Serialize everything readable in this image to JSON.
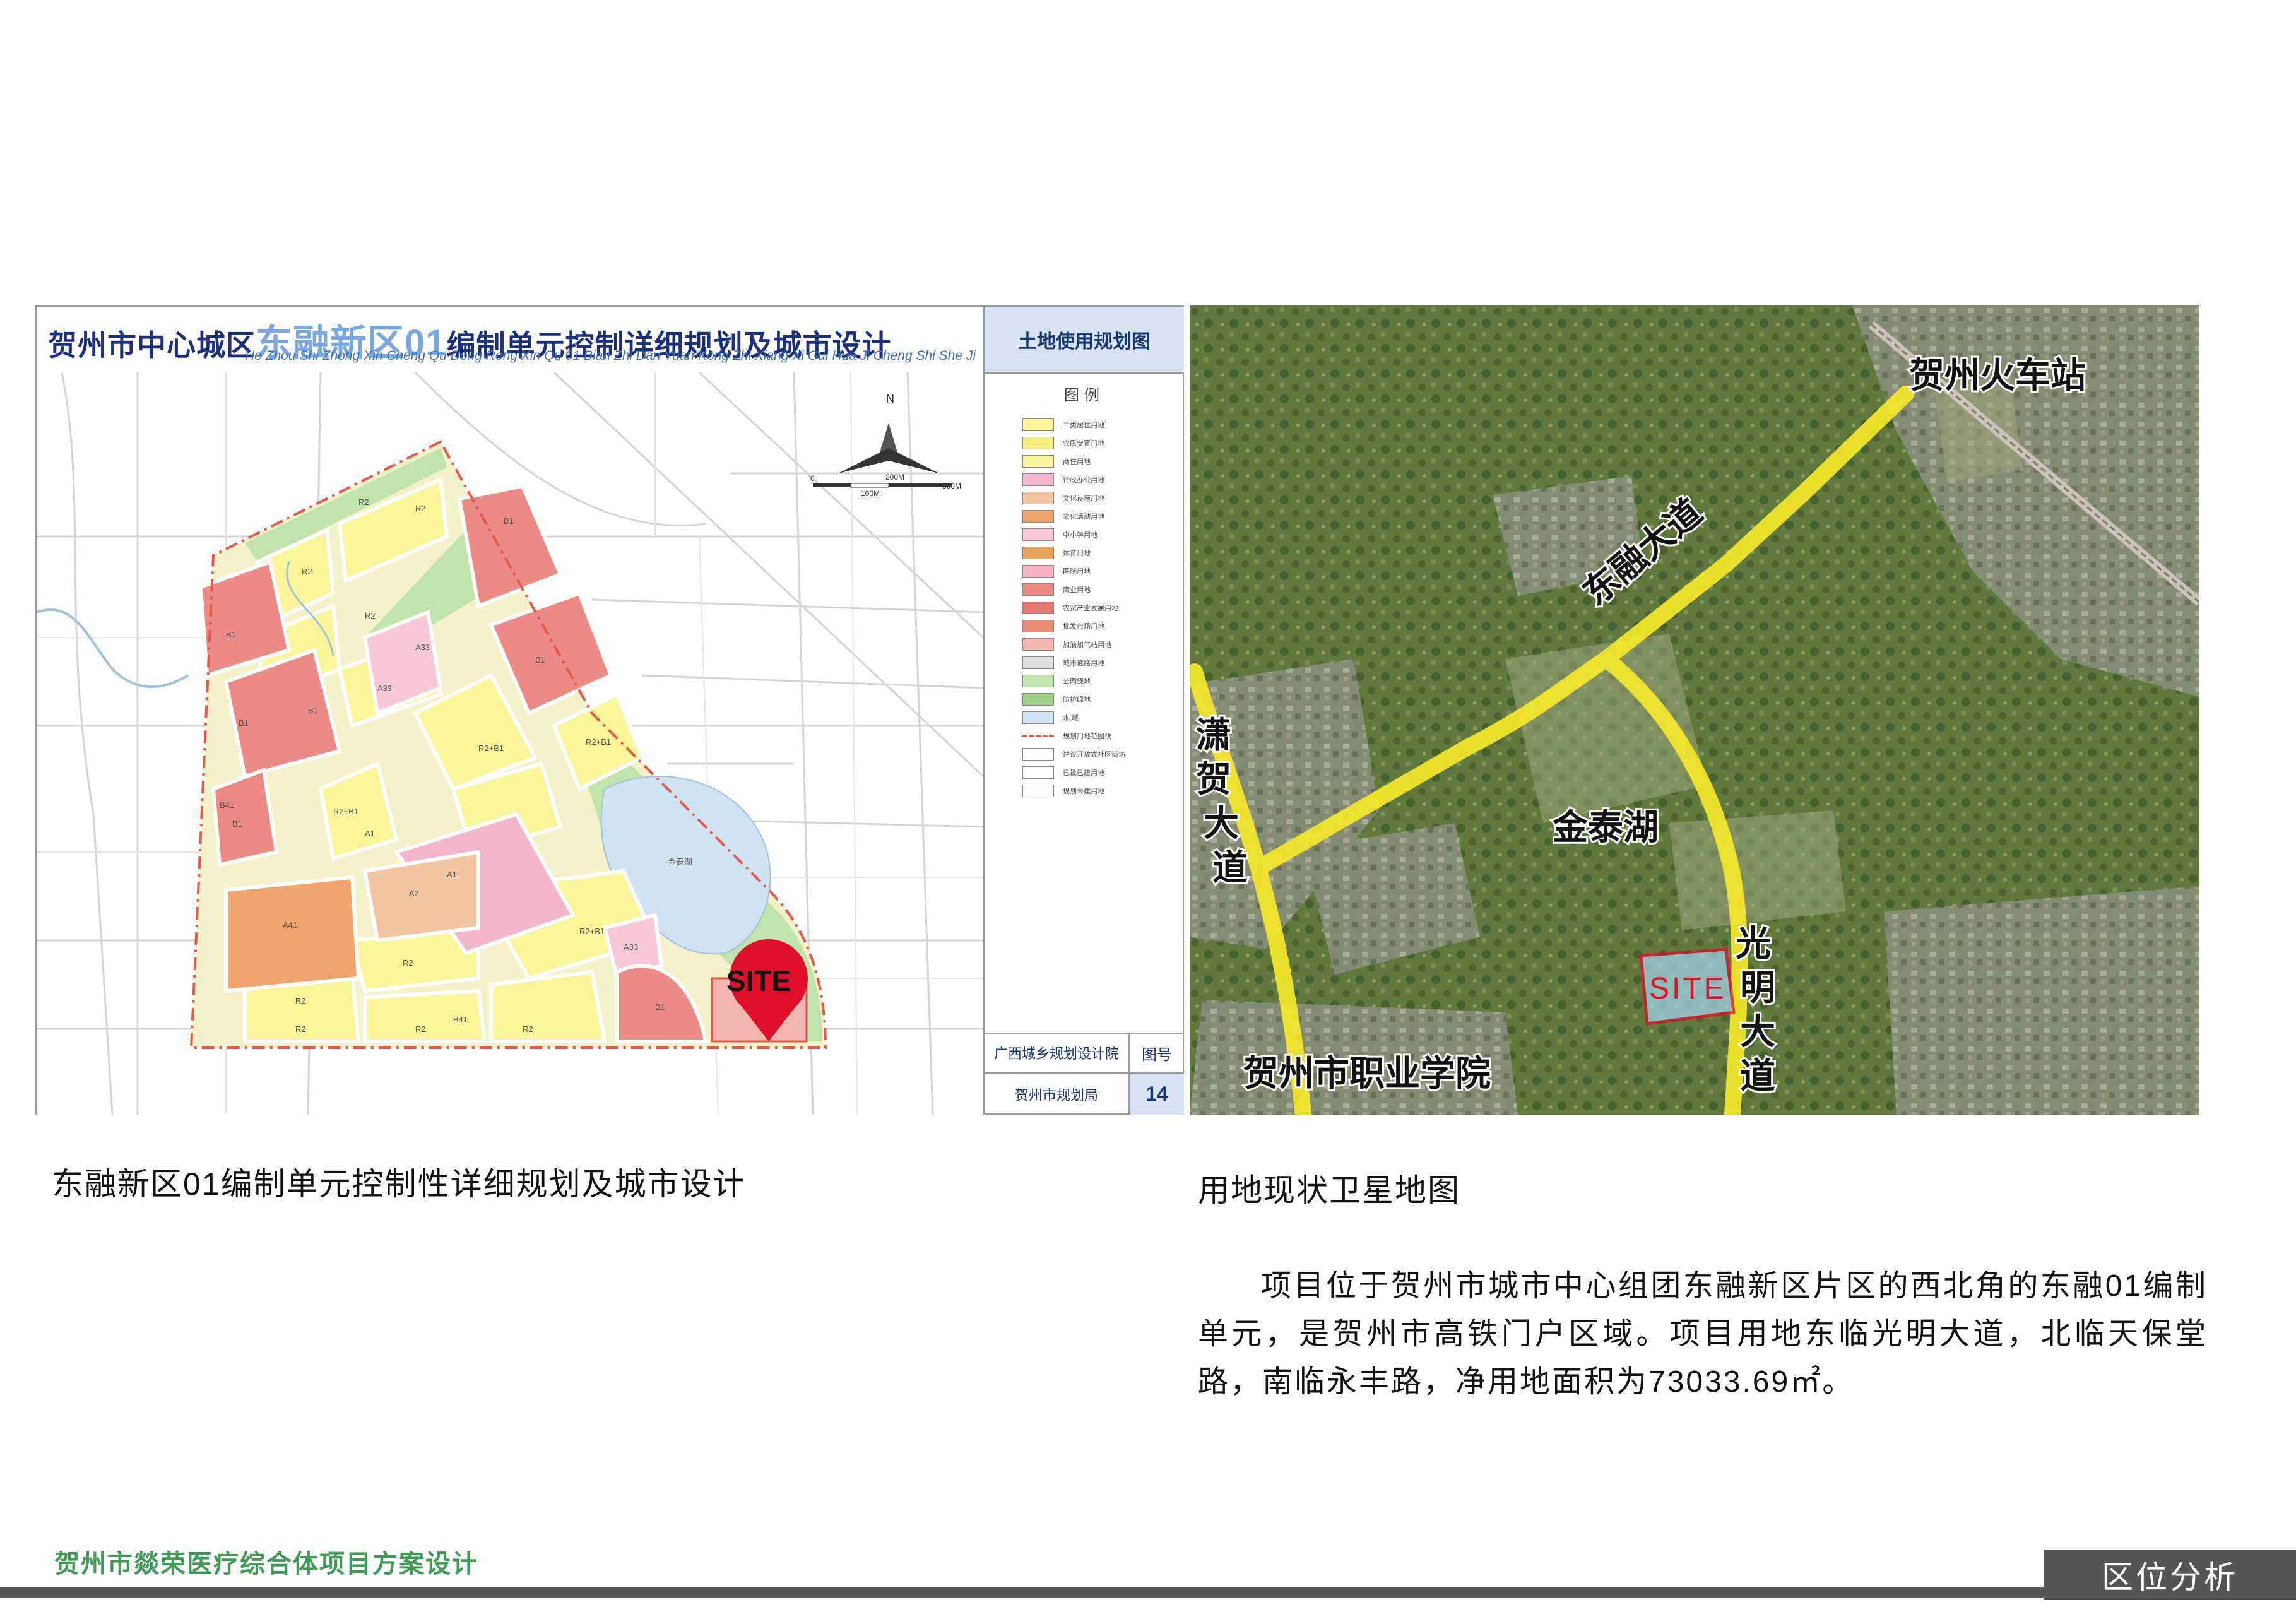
{
  "plan_map": {
    "title_prefix": "贺州市中心城区",
    "title_highlight": "东融新区01",
    "title_suffix": "编制单元控制详细规划及城市设计",
    "pinyin": "He Zhou Shi Zhong Xin Cheng Qu Dong Rong Xin Qu 01 Bian Zhi Dan Yuan Kong Zhi Xiang Xi Gui Hua Ji Cheng Shi She Ji",
    "side_title": "土地使用规划图",
    "legend_title": "图例",
    "legend": [
      {
        "label": "二类居住用地",
        "color": "#fbf59a"
      },
      {
        "label": "农民安置用地",
        "color": "#f4ee7f"
      },
      {
        "label": "商住用地",
        "color": "#f6f39b"
      },
      {
        "label": "行政办公用地",
        "color": "#f6b6c9"
      },
      {
        "label": "文化设施用地",
        "color": "#f3c5a0"
      },
      {
        "label": "文化活动用地",
        "color": "#f0a56d"
      },
      {
        "label": "中小学用地",
        "color": "#f6c8d8"
      },
      {
        "label": "体育用地",
        "color": "#e9a25a"
      },
      {
        "label": "医院用地",
        "color": "#f6b2c1"
      },
      {
        "label": "商业用地",
        "color": "#ec8a86"
      },
      {
        "label": "农贸产业发展用地",
        "color": "#e87a75"
      },
      {
        "label": "批发市场用地",
        "color": "#ee8c7c"
      },
      {
        "label": "加油加气站用地",
        "color": "#f2b5b0"
      },
      {
        "label": "城市道路用地",
        "color": "#dddddd"
      },
      {
        "label": "公园绿地",
        "color": "#bfe3a8"
      },
      {
        "label": "防护绿地",
        "color": "#9fd18a"
      },
      {
        "label": "水 域",
        "color": "#cfe3f2"
      },
      {
        "label": "规划用地范围线",
        "color": "#e35a4a"
      },
      {
        "label": "建议开放式社区街坊",
        "color": "#ffffff"
      },
      {
        "label": "已批已建用地",
        "color": "#ffffff"
      },
      {
        "label": "规划未建用地",
        "color": "#ffffff"
      }
    ],
    "institute": "广西城乡规划设计院",
    "bureau": "贺州市规划局",
    "fig_label": "图号",
    "fig_number": "14",
    "north": "N",
    "scale_200": "200M",
    "scale_300": "300M",
    "scale_100": "100M",
    "scale_0": "0",
    "lake_label": "金泰湖",
    "site_label": "SITE",
    "parcel_labels": [
      "R2",
      "R2",
      "R2",
      "R2",
      "B1",
      "B1",
      "B1",
      "B1",
      "A33",
      "A33",
      "R2+B1",
      "R2+B1",
      "R2+B1",
      "R2+B1",
      "A1",
      "A1",
      "A2",
      "A41",
      "A33",
      "R2",
      "R2",
      "R2",
      "R2",
      "R2",
      "B1",
      "B41",
      "B1",
      "B41",
      "B1"
    ]
  },
  "satellite": {
    "train_station": "贺州火车站",
    "road_dongrong": "东融大道",
    "road_xiaohe": "潇贺大道",
    "lake": "金泰湖",
    "road_guangming": "光明大道",
    "college": "贺州市职业学院",
    "site_label": "SITE"
  },
  "captions": {
    "left": "东融新区01编制单元控制性详细规划及城市设计",
    "right": "用地现状卫星地图"
  },
  "description": "项目位于贺州市城市中心组团东融新区片区的西北角的东融01编制单元，是贺州市高铁门户区域。项目用地东临光明大道，北临天保堂路，南临永丰路，净用地面积为73033.69㎡。",
  "footer": {
    "project_title": "贺州市燚荣医疗综合体项目方案设计",
    "section": "区位分析"
  },
  "colors": {
    "accent_green": "#3f9a55",
    "footer_bar": "#555555",
    "road_yellow": "#f6e82a",
    "site_red": "#e0102a"
  }
}
